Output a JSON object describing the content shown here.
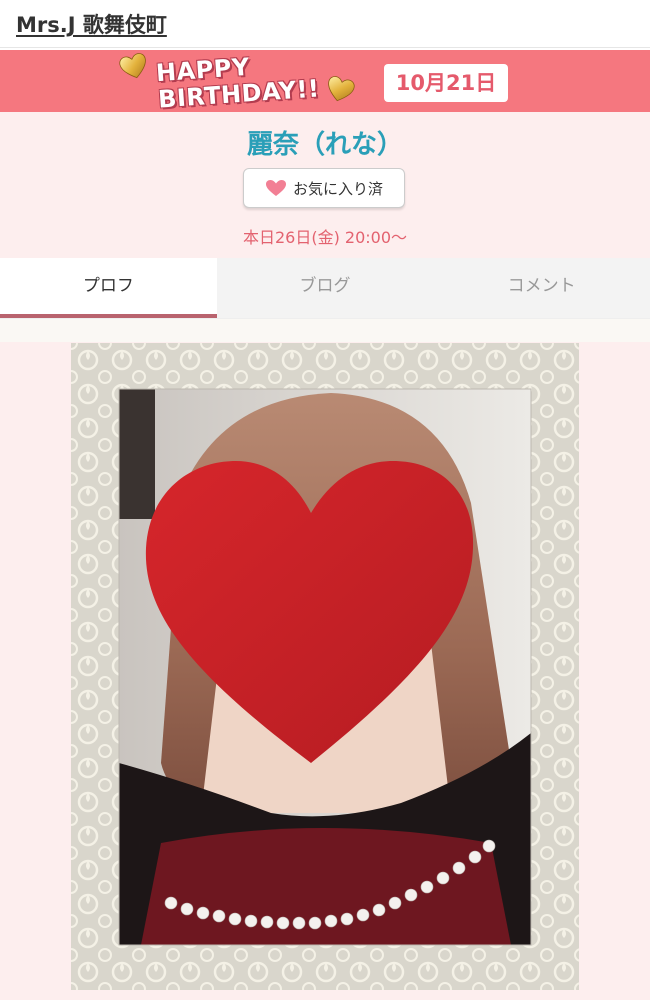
{
  "header": {
    "site_title": "Mrs.J 歌舞伎町"
  },
  "banner": {
    "birthday_line1": "HAPPY",
    "birthday_line2": "BIRTHDAY!!",
    "birthday_date_month": "10月",
    "birthday_date_day": "21日",
    "background_color": "#f5777f",
    "heart_icon": "gold-heart-icon"
  },
  "profile": {
    "name": "麗奈（れな）",
    "favorite_label": "お気に入り済",
    "favorite_icon": "heart-icon",
    "schedule": "本日26日(金) 20:00〜"
  },
  "tabs": [
    {
      "label": "プロフ",
      "active": true
    },
    {
      "label": "ブログ",
      "active": false
    },
    {
      "label": "コメント",
      "active": false
    }
  ],
  "colors": {
    "name_color": "#2a9fb8",
    "schedule_color": "#e3626f",
    "active_tab_underline": "#b9636e",
    "page_background": "#fdeeee"
  }
}
